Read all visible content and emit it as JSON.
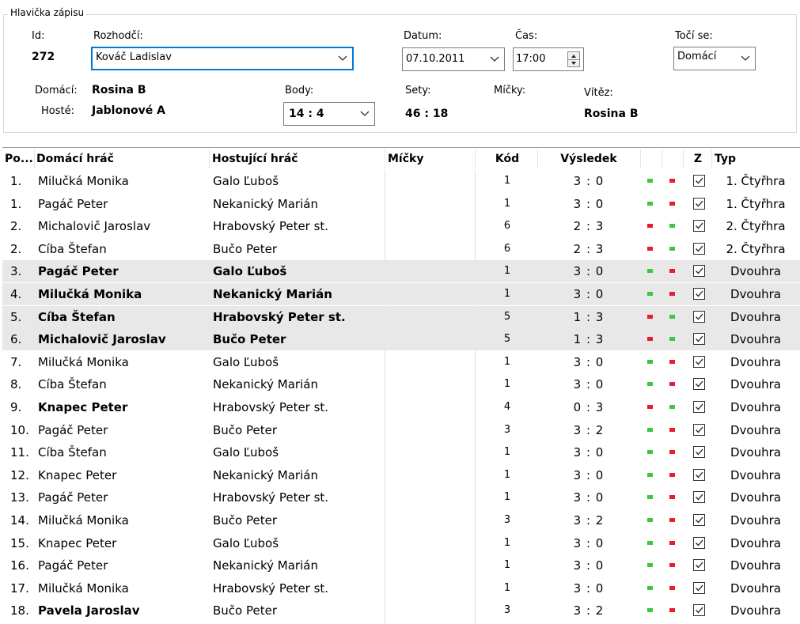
{
  "header": {
    "group_title": "Hlavička zápisu",
    "id_label": "Id:",
    "id_value": "272",
    "referee_label": "Rozhodčí:",
    "referee_value": "Kováč Ladislav",
    "date_label": "Datum:",
    "date_value": "07.10.2011",
    "time_label": "Čas:",
    "time_value": "17:00",
    "turn_label": "Točí se:",
    "turn_value": "Domácí",
    "home_label": "Domácí:",
    "home_value": "Rosina B",
    "guest_label": "Hosté:",
    "guest_value": "Jablonové A",
    "points_label": "Body:",
    "points_value": "14 : 4",
    "sets_label": "Sety:",
    "sets_value": "46 : 18",
    "balls_label": "Míčky:",
    "winner_label": "Vítěz:",
    "winner_value": "Rosina B"
  },
  "table": {
    "columns": {
      "order": "Po...",
      "home": "Domácí hráč",
      "guest": "Hostující hráč",
      "balls": "Míčky",
      "code": "Kód",
      "result": "Výsledek",
      "z": "Z",
      "type": "Typ"
    },
    "colors": {
      "green": "#3cc83c",
      "red": "#e81c2c"
    },
    "rows": [
      {
        "order": "1.",
        "home": "Milučká Monika",
        "guest": "Galo Ľuboš",
        "code": "1",
        "result": "3 : 0",
        "homeBold": false,
        "guestBold": false,
        "hl": false,
        "leds": [
          "green",
          "red"
        ],
        "type": "1. Čtyřhra"
      },
      {
        "order": "1.",
        "home": "Pagáč Peter",
        "guest": "Nekanický Marián",
        "code": "1",
        "result": "3 : 0",
        "homeBold": false,
        "guestBold": false,
        "hl": false,
        "leds": [
          "green",
          "red"
        ],
        "type": "1. Čtyřhra"
      },
      {
        "order": "2.",
        "home": "Michalovič Jaroslav",
        "guest": "Hrabovský Peter st.",
        "code": "6",
        "result": "2 : 3",
        "homeBold": false,
        "guestBold": false,
        "hl": false,
        "leds": [
          "red",
          "green"
        ],
        "type": "2. Čtyřhra"
      },
      {
        "order": "2.",
        "home": "Cíba Štefan",
        "guest": "Bučo Peter",
        "code": "6",
        "result": "2 : 3",
        "homeBold": false,
        "guestBold": false,
        "hl": false,
        "leds": [
          "red",
          "green"
        ],
        "type": "2. Čtyřhra"
      },
      {
        "order": "3.",
        "home": "Pagáč Peter",
        "guest": "Galo Ľuboš",
        "code": "1",
        "result": "3 : 0",
        "homeBold": true,
        "guestBold": true,
        "hl": true,
        "leds": [
          "green",
          "red"
        ],
        "type": "Dvouhra"
      },
      {
        "order": "4.",
        "home": "Milučká Monika",
        "guest": "Nekanický Marián",
        "code": "1",
        "result": "3 : 0",
        "homeBold": true,
        "guestBold": true,
        "hl": true,
        "leds": [
          "green",
          "red"
        ],
        "type": "Dvouhra"
      },
      {
        "order": "5.",
        "home": "Cíba Štefan",
        "guest": "Hrabovský Peter st.",
        "code": "5",
        "result": "1 : 3",
        "homeBold": true,
        "guestBold": true,
        "hl": true,
        "leds": [
          "red",
          "green"
        ],
        "type": "Dvouhra"
      },
      {
        "order": "6.",
        "home": "Michalovič Jaroslav",
        "guest": "Bučo Peter",
        "code": "5",
        "result": "1 : 3",
        "homeBold": true,
        "guestBold": true,
        "hl": true,
        "leds": [
          "red",
          "green"
        ],
        "type": "Dvouhra"
      },
      {
        "order": "7.",
        "home": "Milučká Monika",
        "guest": "Galo Ľuboš",
        "code": "1",
        "result": "3 : 0",
        "homeBold": false,
        "guestBold": false,
        "hl": false,
        "leds": [
          "green",
          "red"
        ],
        "type": "Dvouhra"
      },
      {
        "order": "8.",
        "home": "Cíba Štefan",
        "guest": "Nekanický Marián",
        "code": "1",
        "result": "3 : 0",
        "homeBold": false,
        "guestBold": false,
        "hl": false,
        "leds": [
          "green",
          "red"
        ],
        "type": "Dvouhra"
      },
      {
        "order": "9.",
        "home": "Knapec Peter",
        "guest": "Hrabovský Peter st.",
        "code": "4",
        "result": "0 : 3",
        "homeBold": true,
        "guestBold": false,
        "hl": false,
        "leds": [
          "red",
          "green"
        ],
        "type": "Dvouhra"
      },
      {
        "order": "10.",
        "home": "Pagáč Peter",
        "guest": "Bučo Peter",
        "code": "3",
        "result": "3 : 2",
        "homeBold": false,
        "guestBold": false,
        "hl": false,
        "leds": [
          "green",
          "red"
        ],
        "type": "Dvouhra"
      },
      {
        "order": "11.",
        "home": "Cíba Štefan",
        "guest": "Galo Ľuboš",
        "code": "1",
        "result": "3 : 0",
        "homeBold": false,
        "guestBold": false,
        "hl": false,
        "leds": [
          "green",
          "red"
        ],
        "type": "Dvouhra"
      },
      {
        "order": "12.",
        "home": "Knapec Peter",
        "guest": "Nekanický Marián",
        "code": "1",
        "result": "3 : 0",
        "homeBold": false,
        "guestBold": false,
        "hl": false,
        "leds": [
          "green",
          "red"
        ],
        "type": "Dvouhra"
      },
      {
        "order": "13.",
        "home": "Pagáč Peter",
        "guest": "Hrabovský Peter st.",
        "code": "1",
        "result": "3 : 0",
        "homeBold": false,
        "guestBold": false,
        "hl": false,
        "leds": [
          "green",
          "red"
        ],
        "type": "Dvouhra"
      },
      {
        "order": "14.",
        "home": "Milučká Monika",
        "guest": "Bučo Peter",
        "code": "3",
        "result": "3 : 2",
        "homeBold": false,
        "guestBold": false,
        "hl": false,
        "leds": [
          "green",
          "red"
        ],
        "type": "Dvouhra"
      },
      {
        "order": "15.",
        "home": "Knapec Peter",
        "guest": "Galo Ľuboš",
        "code": "1",
        "result": "3 : 0",
        "homeBold": false,
        "guestBold": false,
        "hl": false,
        "leds": [
          "green",
          "red"
        ],
        "type": "Dvouhra"
      },
      {
        "order": "16.",
        "home": "Pagáč Peter",
        "guest": "Nekanický Marián",
        "code": "1",
        "result": "3 : 0",
        "homeBold": false,
        "guestBold": false,
        "hl": false,
        "leds": [
          "green",
          "red"
        ],
        "type": "Dvouhra"
      },
      {
        "order": "17.",
        "home": "Milučká Monika",
        "guest": "Hrabovský Peter st.",
        "code": "1",
        "result": "3 : 0",
        "homeBold": false,
        "guestBold": false,
        "hl": false,
        "leds": [
          "green",
          "red"
        ],
        "type": "Dvouhra"
      },
      {
        "order": "18.",
        "home": "Pavela Jaroslav",
        "guest": "Bučo Peter",
        "code": "3",
        "result": "3 : 2",
        "homeBold": true,
        "guestBold": false,
        "hl": false,
        "leds": [
          "green",
          "red"
        ],
        "type": "Dvouhra"
      }
    ]
  }
}
